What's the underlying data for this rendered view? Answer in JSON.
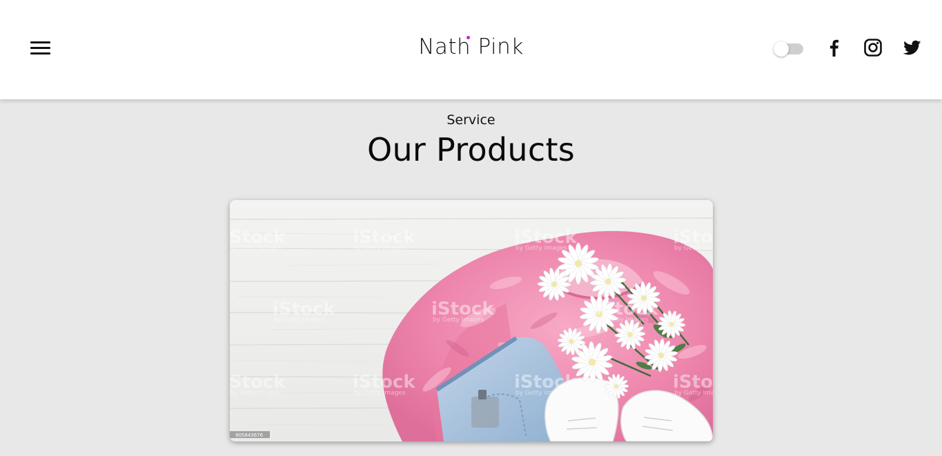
{
  "header": {
    "logo_text": "Nath Pink",
    "accent_color": "#c026d3",
    "menu_icon": "hamburger-menu-icon",
    "theme_toggle": {
      "state": "off"
    },
    "social": [
      {
        "name": "facebook",
        "icon": "facebook-icon"
      },
      {
        "name": "instagram",
        "icon": "instagram-icon"
      },
      {
        "name": "twitter",
        "icon": "twitter-icon"
      }
    ]
  },
  "section": {
    "kicker": "Service",
    "title": "Our Products"
  },
  "product_image": {
    "subject": "pink velvet top, denim shorts, white sneakers and white daisies on white wood",
    "watermark_text": "iStock",
    "watermark_sub": "by Getty Images",
    "image_id_tag": "905843676"
  }
}
